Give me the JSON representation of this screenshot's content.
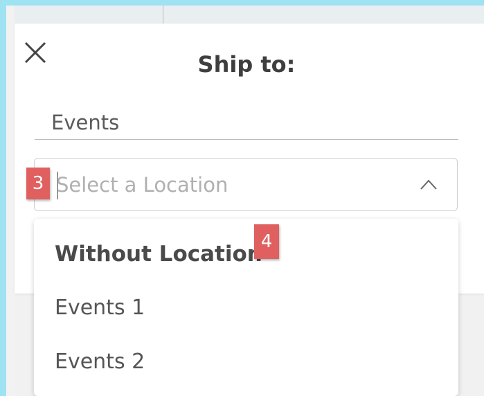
{
  "dialog": {
    "title": "Ship to:",
    "close_icon": "close-icon"
  },
  "form": {
    "events_value": "Events",
    "location_placeholder": "Select a Location",
    "chevron_icon": "chevron-up-icon"
  },
  "dropdown": {
    "items": [
      {
        "label": "Without Location",
        "bold": true
      },
      {
        "label": "Events 1",
        "bold": false
      },
      {
        "label": "Events 2",
        "bold": false
      }
    ]
  },
  "annotations": {
    "badge_location_field": "3",
    "badge_without_location": "4"
  }
}
